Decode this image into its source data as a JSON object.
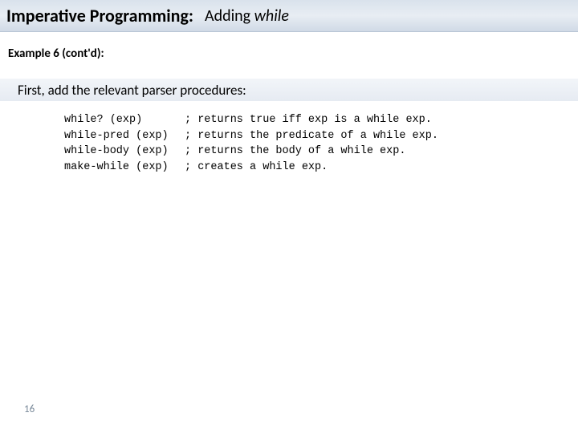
{
  "title": {
    "main": "Imperative Programming:",
    "sub_prefix": "Adding ",
    "sub_italic": "while"
  },
  "example_label": "Example 6 (cont'd):",
  "intro": "First, add the relevant parser procedures:",
  "code": [
    {
      "left": "while? (exp)",
      "right": "; returns true iff exp is a while exp."
    },
    {
      "left": "while-pred (exp)",
      "right": "; returns the predicate of a while exp."
    },
    {
      "left": "while-body (exp)",
      "right": "; returns the body of a while exp."
    },
    {
      "left": "make-while (exp)",
      "right": "; creates a while exp."
    }
  ],
  "page_number": "16"
}
